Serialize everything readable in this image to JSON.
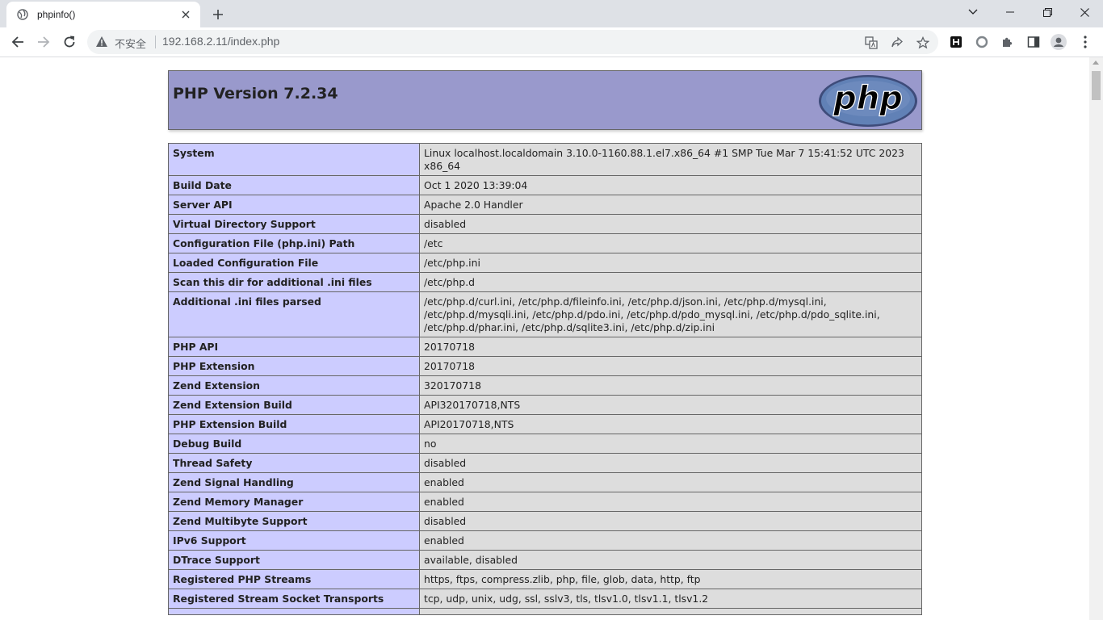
{
  "browser": {
    "tab_title": "phpinfo()",
    "security_label": "不安全",
    "url": "192.168.2.11/index.php"
  },
  "page": {
    "title": "PHP Version 7.2.34",
    "logo_text": "php",
    "rows": [
      {
        "label": "System",
        "value": "Linux localhost.localdomain 3.10.0-1160.88.1.el7.x86_64 #1 SMP Tue Mar 7 15:41:52 UTC 2023 x86_64"
      },
      {
        "label": "Build Date",
        "value": "Oct 1 2020 13:39:04"
      },
      {
        "label": "Server API",
        "value": "Apache 2.0 Handler"
      },
      {
        "label": "Virtual Directory Support",
        "value": "disabled"
      },
      {
        "label": "Configuration File (php.ini) Path",
        "value": "/etc"
      },
      {
        "label": "Loaded Configuration File",
        "value": "/etc/php.ini"
      },
      {
        "label": "Scan this dir for additional .ini files",
        "value": "/etc/php.d"
      },
      {
        "label": "Additional .ini files parsed",
        "value": "/etc/php.d/curl.ini, /etc/php.d/fileinfo.ini, /etc/php.d/json.ini, /etc/php.d/mysql.ini, /etc/php.d/mysqli.ini, /etc/php.d/pdo.ini, /etc/php.d/pdo_mysql.ini, /etc/php.d/pdo_sqlite.ini, /etc/php.d/phar.ini, /etc/php.d/sqlite3.ini, /etc/php.d/zip.ini"
      },
      {
        "label": "PHP API",
        "value": "20170718"
      },
      {
        "label": "PHP Extension",
        "value": "20170718"
      },
      {
        "label": "Zend Extension",
        "value": "320170718"
      },
      {
        "label": "Zend Extension Build",
        "value": "API320170718,NTS"
      },
      {
        "label": "PHP Extension Build",
        "value": "API20170718,NTS"
      },
      {
        "label": "Debug Build",
        "value": "no"
      },
      {
        "label": "Thread Safety",
        "value": "disabled"
      },
      {
        "label": "Zend Signal Handling",
        "value": "enabled"
      },
      {
        "label": "Zend Memory Manager",
        "value": "enabled"
      },
      {
        "label": "Zend Multibyte Support",
        "value": "disabled"
      },
      {
        "label": "IPv6 Support",
        "value": "enabled"
      },
      {
        "label": "DTrace Support",
        "value": "available, disabled"
      },
      {
        "label": "Registered PHP Streams",
        "value": "https, ftps, compress.zlib, php, file, glob, data, http, ftp"
      },
      {
        "label": "Registered Stream Socket Transports",
        "value": "tcp, udp, unix, udg, ssl, sslv3, tls, tlsv1.0, tlsv1.1, tlsv1.2"
      },
      {
        "label": "",
        "value": ""
      }
    ]
  },
  "colors": {
    "header_bg": "#9999cc",
    "label_bg": "#ccccff",
    "value_bg": "#dddddd",
    "logo_bg": "#6181b6"
  }
}
